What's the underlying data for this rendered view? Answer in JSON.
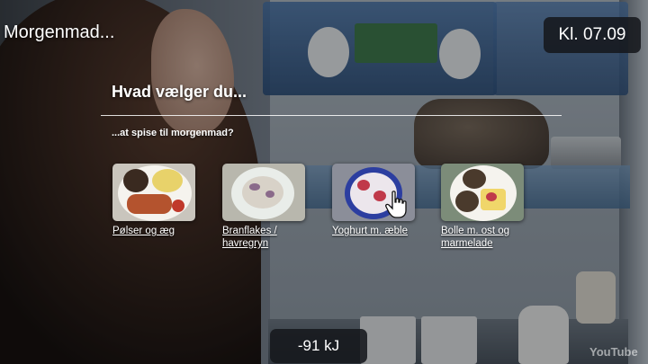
{
  "header": {
    "title": "Morgenmad...",
    "clock": "Kl. 07.09"
  },
  "prompt": {
    "question": "Hvad vælger du...",
    "subtitle": "...at spise til morgenmad?"
  },
  "options": [
    {
      "label": "Pølser og æg",
      "icon": "sausages-eggs-plate"
    },
    {
      "label": "Branflakes / havregryn",
      "icon": "cereal-bowl"
    },
    {
      "label": "Yoghurt m. æble",
      "icon": "yoghurt-apple-bowl"
    },
    {
      "label": "Bolle m. ost og marmelade",
      "icon": "bun-cheese-jam-plate"
    }
  ],
  "energy": {
    "value": "-91 kJ"
  },
  "cursor": {
    "icon": "hand-pointer-icon"
  },
  "watermark": {
    "text": "YouTube"
  },
  "colors": {
    "text": "#ffffff",
    "badge_bg": "#16181c",
    "tray_blue": "#46739f"
  }
}
